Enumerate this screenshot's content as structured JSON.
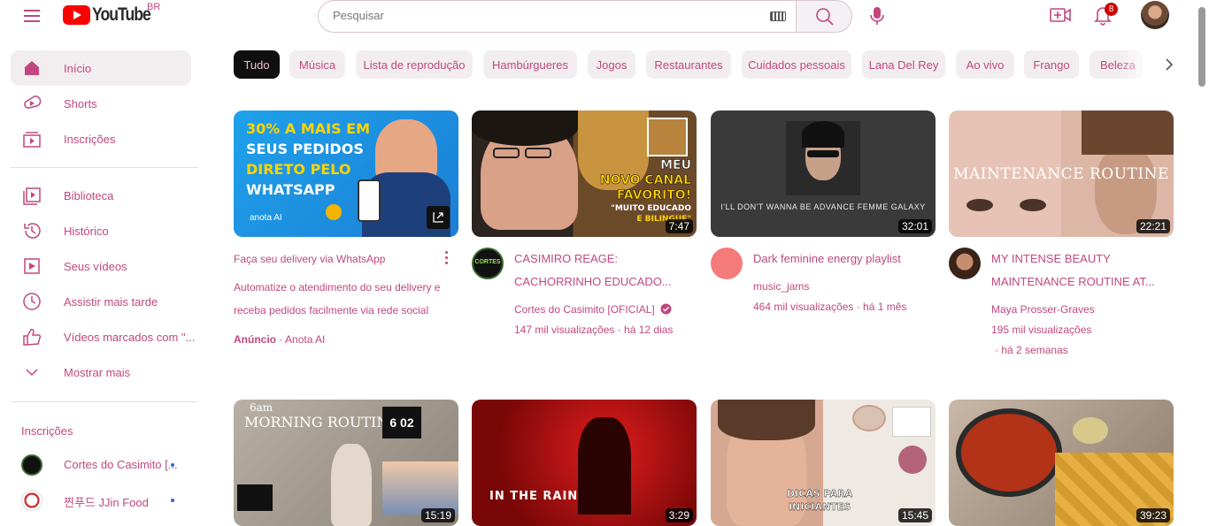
{
  "header": {
    "logo_text": "YouTube",
    "country": "BR",
    "search_placeholder": "Pesquisar",
    "notifications_count": "8"
  },
  "sidebar": {
    "items": [
      {
        "label": "Início",
        "icon": "home-icon"
      },
      {
        "label": "Shorts",
        "icon": "shorts-icon"
      },
      {
        "label": "Inscrições",
        "icon": "subscriptions-icon"
      },
      {
        "label": "Biblioteca",
        "icon": "library-icon"
      },
      {
        "label": "Histórico",
        "icon": "history-icon"
      },
      {
        "label": "Seus vídeos",
        "icon": "your-videos-icon"
      },
      {
        "label": "Assistir mais tarde",
        "icon": "watch-later-icon"
      },
      {
        "label": "Vídeos marcados com \"...",
        "icon": "liked-videos-icon"
      },
      {
        "label": "Mostrar mais",
        "icon": "chevron-down-icon"
      }
    ],
    "subscriptions_title": "Inscrições",
    "subscriptions": [
      {
        "label": "Cortes do Casimito [..."
      },
      {
        "label": "찐푸드 JJin Food"
      }
    ]
  },
  "chips": [
    "Tudo",
    "Música",
    "Lista de reprodução",
    "Hambúrgueres",
    "Jogos",
    "Restaurantes",
    "Cuidados pessoais",
    "Lana Del Rey",
    "Ao vivo",
    "Frango",
    "Beleza"
  ],
  "videos": [
    {
      "title": "Faça seu delivery via WhatsApp",
      "desc1": "Automatize o atendimento do seu delivery e",
      "desc2": "receba pedidos facilmente via rede social",
      "ad_label": "Anúncio",
      "advertiser": "· Anota AI",
      "thumb_lines": [
        "30% A MAIS EM",
        "SEUS PEDIDOS",
        "DIRETO PELO",
        "WHATSAPP"
      ],
      "thumb_brand": "anota AI"
    },
    {
      "title1": "CASIMIRO REAGE:",
      "title2": "CACHORRINHO EDUCADO...",
      "channel": "Cortes do Casimito [OFICIAL]",
      "stats": "147 mil visualizações · há 12 dias",
      "duration": "7:47",
      "thumb_lines": [
        "MEU",
        "NOVO CANAL",
        "FAVORITO!"
      ],
      "thumb_sub": [
        "\"MUITO EDUCADO",
        "E BILINGUE\""
      ],
      "avatar_text": "CORTES"
    },
    {
      "title": "Dark feminine energy playlist",
      "channel": "music_jams",
      "stats": "464 mil visualizações · há 1 mês",
      "duration": "32:01",
      "thumb_caption": "I'LL DON'T WANNA BE ADVANCE FEMME GALAXY"
    },
    {
      "title1": "MY INTENSE BEAUTY",
      "title2": "MAINTENANCE ROUTINE AT...",
      "channel": "Maya Prosser-Graves",
      "stats1": "195 mil visualizações",
      "stats2": "· há 2 semanas",
      "duration": "22:21",
      "thumb_text": "MAINTENANCE ROUTINE"
    },
    {
      "duration": "15:19",
      "thumb_small": "6am",
      "thumb_text": "MORNING ROUTINE.",
      "thumb_clock": "6 02"
    },
    {
      "duration": "3:29",
      "thumb_text": "IN THE RAIN"
    },
    {
      "duration": "15:45",
      "thumb_lines": [
        "DICAS PARA",
        "INICIANTES"
      ]
    },
    {
      "duration": "39:23"
    }
  ]
}
